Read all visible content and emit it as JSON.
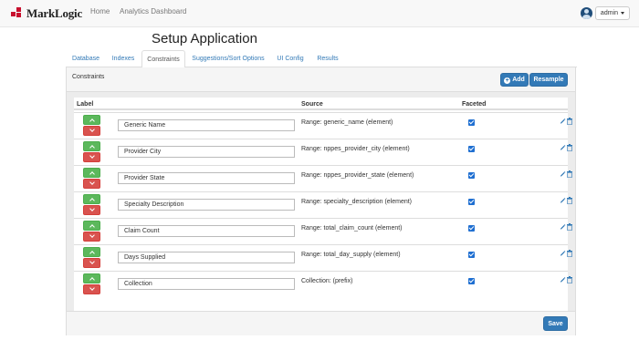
{
  "navbar": {
    "brand": "MarkLogic",
    "links": [
      "Home",
      "Analytics Dashboard"
    ],
    "user": "admin"
  },
  "page_title": "Setup Application",
  "tabs": [
    "Database",
    "Indexes",
    "Constraints",
    "Suggestions/Sort Options",
    "UI Config",
    "Results"
  ],
  "active_tab": "Constraints",
  "panel": {
    "title": "Constraints",
    "add_label": "Add",
    "resample_label": "Resample",
    "save_label": "Save"
  },
  "table": {
    "headers": [
      "Label",
      "Source",
      "Faceted"
    ],
    "rows": [
      {
        "label": "Generic Name",
        "source": "Range: generic_name (element)",
        "faceted": true
      },
      {
        "label": "Provider City",
        "source": "Range: nppes_provider_city (element)",
        "faceted": true
      },
      {
        "label": "Provider State",
        "source": "Range: nppes_provider_state (element)",
        "faceted": true
      },
      {
        "label": "Specialty Description",
        "source": "Range: specialty_description (element)",
        "faceted": true
      },
      {
        "label": "Claim Count",
        "source": "Range: total_claim_count (element)",
        "faceted": true
      },
      {
        "label": "Days Supplied",
        "source": "Range: total_day_supply (element)",
        "faceted": true
      },
      {
        "label": "Collection",
        "source": "Collection: (prefix)",
        "faceted": true
      }
    ]
  },
  "icons": {
    "move_up": "chevron-up-icon",
    "move_down": "chevron-down-icon",
    "edit": "pencil-icon",
    "delete": "trash-icon",
    "add": "plus-circle-icon"
  },
  "colors": {
    "brand_red": "#c8102e",
    "primary": "#337ab7",
    "success": "#5cb85c",
    "danger": "#d9534f",
    "checkbox": "#1f6fd1"
  }
}
